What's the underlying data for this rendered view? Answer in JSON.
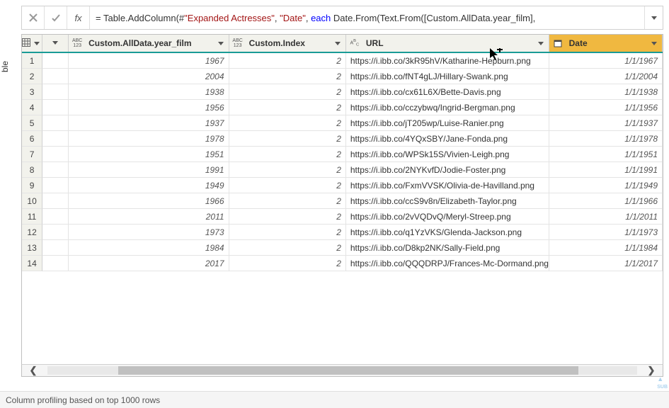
{
  "formula": {
    "prefix": "= Table.AddColumn(#",
    "arg_table": "\"Expanded Actresses\"",
    "sep1": ", ",
    "arg_col": "\"Date\"",
    "sep2": ", ",
    "kw_each": "each",
    "rest": " Date.From(Text.From([Custom.AllData.year_film],"
  },
  "side_tab": "ble",
  "columns": {
    "year": {
      "name": "Custom.AllData.year_film",
      "type": "ABC123"
    },
    "index": {
      "name": "Custom.Index",
      "type": "ABC123"
    },
    "url": {
      "name": "URL",
      "type": "ABC"
    },
    "date": {
      "name": "Date",
      "type": ""
    }
  },
  "rows": [
    {
      "n": "1",
      "year": "1967",
      "index": "2",
      "url": "https://i.ibb.co/3kR95hV/Katharine-Hepburn.png",
      "date": "1/1/1967"
    },
    {
      "n": "2",
      "year": "2004",
      "index": "2",
      "url": "https://i.ibb.co/fNT4gLJ/Hillary-Swank.png",
      "date": "1/1/2004"
    },
    {
      "n": "3",
      "year": "1938",
      "index": "2",
      "url": "https://i.ibb.co/cx61L6X/Bette-Davis.png",
      "date": "1/1/1938"
    },
    {
      "n": "4",
      "year": "1956",
      "index": "2",
      "url": "https://i.ibb.co/cczybwq/Ingrid-Bergman.png",
      "date": "1/1/1956"
    },
    {
      "n": "5",
      "year": "1937",
      "index": "2",
      "url": "https://i.ibb.co/jT205wp/Luise-Ranier.png",
      "date": "1/1/1937"
    },
    {
      "n": "6",
      "year": "1978",
      "index": "2",
      "url": "https://i.ibb.co/4YQxSBY/Jane-Fonda.png",
      "date": "1/1/1978"
    },
    {
      "n": "7",
      "year": "1951",
      "index": "2",
      "url": "https://i.ibb.co/WPSk15S/Vivien-Leigh.png",
      "date": "1/1/1951"
    },
    {
      "n": "8",
      "year": "1991",
      "index": "2",
      "url": "https://i.ibb.co/2NYKvfD/Jodie-Foster.png",
      "date": "1/1/1991"
    },
    {
      "n": "9",
      "year": "1949",
      "index": "2",
      "url": "https://i.ibb.co/FxmVVSK/Olivia-de-Havilland.png",
      "date": "1/1/1949"
    },
    {
      "n": "10",
      "year": "1966",
      "index": "2",
      "url": "https://i.ibb.co/ccS9v8n/Elizabeth-Taylor.png",
      "date": "1/1/1966"
    },
    {
      "n": "11",
      "year": "2011",
      "index": "2",
      "url": "https://i.ibb.co/2vVQDvQ/Meryl-Streep.png",
      "date": "1/1/2011"
    },
    {
      "n": "12",
      "year": "1973",
      "index": "2",
      "url": "https://i.ibb.co/q1YzVKS/Glenda-Jackson.png",
      "date": "1/1/1973"
    },
    {
      "n": "13",
      "year": "1984",
      "index": "2",
      "url": "https://i.ibb.co/D8kp2NK/Sally-Field.png",
      "date": "1/1/1984"
    },
    {
      "n": "14",
      "year": "2017",
      "index": "2",
      "url": "https://i.ibb.co/QQQDRPJ/Frances-Mc-Dormand.png",
      "date": "1/1/2017"
    }
  ],
  "status": "Column profiling based on top 1000 rows",
  "icons": {
    "table": "⊞",
    "calendar": "📅"
  }
}
